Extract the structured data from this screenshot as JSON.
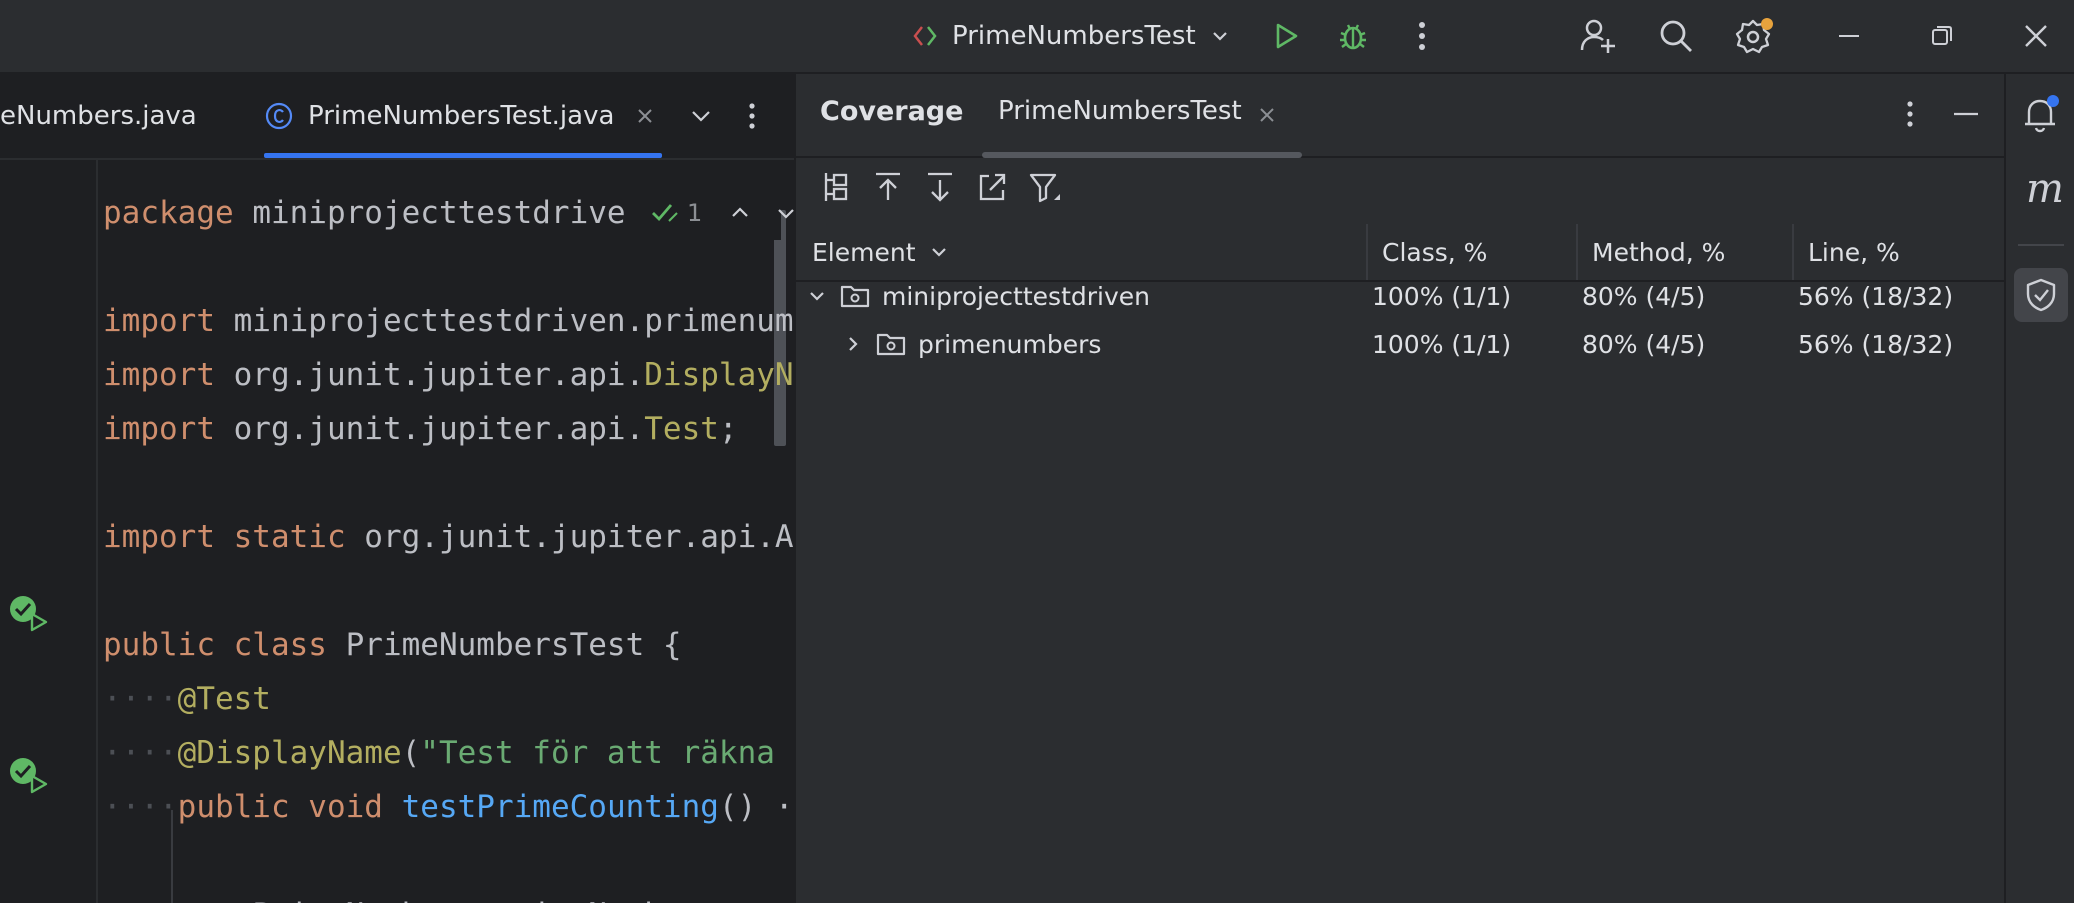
{
  "titlebar": {
    "run_config": "PrimeNumbersTest",
    "icons": [
      "code-with-me-arrows-icon",
      "chevron-down-icon",
      "run-icon",
      "debug-icon",
      "more-vertical-icon",
      "add-user-icon",
      "search-icon",
      "settings-icon",
      "minimize-icon",
      "restore-icon",
      "close-icon"
    ]
  },
  "editor_tabs": [
    {
      "label": "eNumbers.java",
      "active": false
    },
    {
      "label": "PrimeNumbersTest.java",
      "active": true
    }
  ],
  "editor": {
    "inspection_count": "1",
    "lines": [
      {
        "tokens": [
          [
            "kw",
            "package"
          ],
          [
            "pl",
            " miniprojecttestdrive"
          ]
        ]
      },
      {
        "tokens": [
          [
            "kw",
            "import"
          ],
          [
            "pl",
            " miniprojecttestdriven.primenum"
          ]
        ]
      },
      {
        "tokens": [
          [
            "kw",
            "import"
          ],
          [
            "pl",
            " org.junit.jupiter.api."
          ],
          [
            "an",
            "DisplayN"
          ]
        ]
      },
      {
        "tokens": [
          [
            "kw",
            "import"
          ],
          [
            "pl",
            " org.junit.jupiter.api."
          ],
          [
            "an",
            "Test"
          ],
          [
            "pl",
            ";"
          ]
        ]
      },
      {
        "tokens": [
          [
            "kw",
            "import static"
          ],
          [
            "pl",
            " org.junit.jupiter.api.A"
          ]
        ]
      },
      {
        "tokens": [
          [
            "kw",
            "public class"
          ],
          [
            "pl",
            " PrimeNumbersTest {"
          ]
        ]
      },
      {
        "tokens": [
          [
            "dot",
            "····"
          ],
          [
            "an",
            "@Test"
          ]
        ]
      },
      {
        "tokens": [
          [
            "dot",
            "····"
          ],
          [
            "an",
            "@DisplayName"
          ],
          [
            "pl",
            "("
          ],
          [
            "st",
            "\"Test för att räkna"
          ]
        ]
      },
      {
        "tokens": [
          [
            "dot",
            "····"
          ],
          [
            "kw",
            "public void"
          ],
          [
            "pl",
            " "
          ],
          [
            "fn",
            "testPrimeCounting"
          ],
          [
            "pl",
            "() ·"
          ]
        ]
      },
      {
        "tokens": [
          [
            "dot",
            "········"
          ],
          [
            "pl",
            "PrimeNumbers primeNumbers = "
          ],
          [
            "kw",
            "n"
          ]
        ]
      }
    ]
  },
  "coverage": {
    "tab_title": "Coverage",
    "run_tab": "PrimeNumbersTest",
    "columns": [
      "Element",
      "Class, %",
      "Method, %",
      "Line, %"
    ],
    "rows": [
      {
        "name": "miniprojecttestdriven",
        "class": "100% (1/1)",
        "method": "80% (4/5)",
        "line": "56% (18/32)",
        "expanded": true
      },
      {
        "name": "primenumbers",
        "class": "100% (1/1)",
        "method": "80% (4/5)",
        "line": "56% (18/32)",
        "expanded": false
      }
    ]
  },
  "right_strip": {
    "letter": "m"
  },
  "colors": {
    "accent": "#3574f0",
    "run_green": "#5fb865",
    "warning_orange": "#e8a33d"
  }
}
